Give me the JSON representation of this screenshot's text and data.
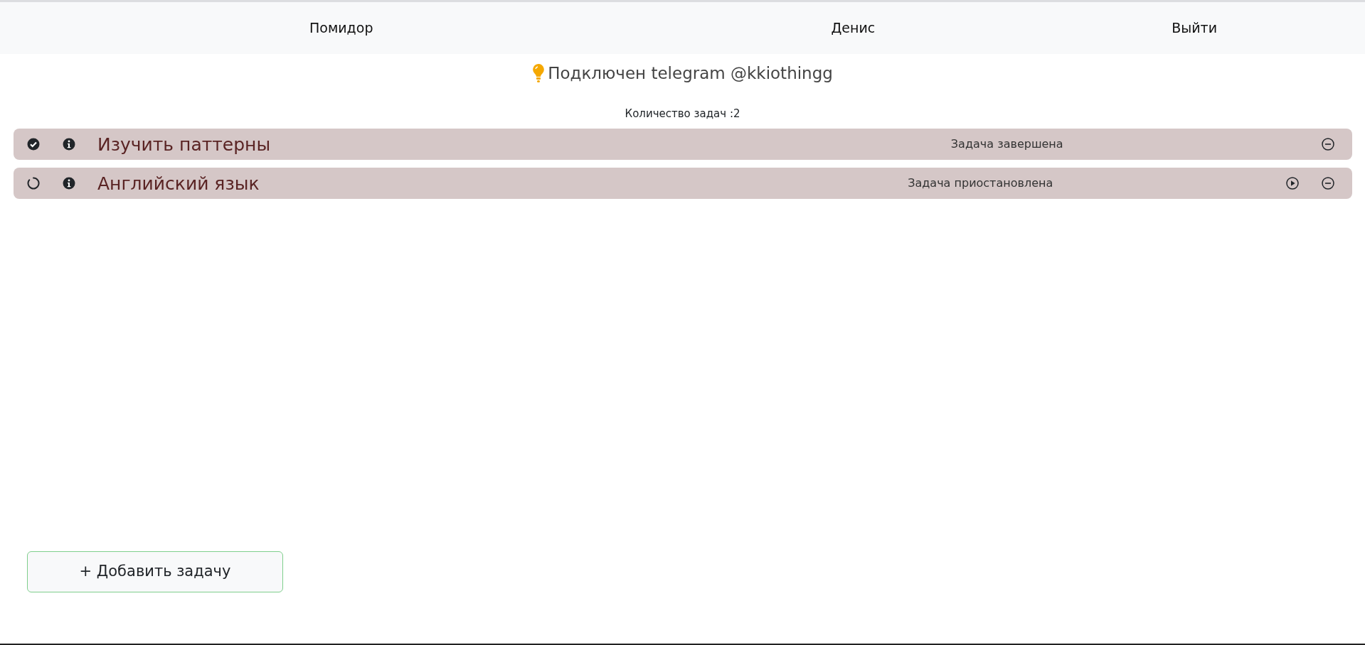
{
  "navbar": {
    "items": [
      "Помидор",
      "Денис",
      "Выйти"
    ]
  },
  "telegram_status": "Подключен telegram @kkiothingg",
  "task_count": "Количество задач :2",
  "tasks": [
    {
      "title": "Изучить паттерны",
      "status": "Задача завершена",
      "kind": "done"
    },
    {
      "title": "Английский язык",
      "status": "Задача приостановлена",
      "kind": "paused"
    }
  ],
  "add_button": "+ Добавить задачу"
}
